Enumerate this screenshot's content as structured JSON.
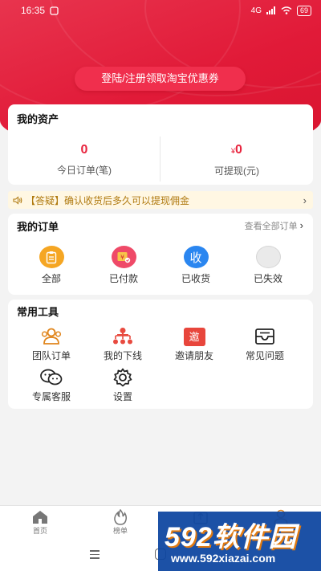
{
  "status_bar": {
    "time": "16:35",
    "network": "4G",
    "battery": "69"
  },
  "header": {
    "coupon_button": "登陆/注册领取淘宝优惠券"
  },
  "assets": {
    "title": "我的资产",
    "today_orders_value": "0",
    "today_orders_label": "今日订单(笔)",
    "withdrawable_currency": "¥",
    "withdrawable_value": "0",
    "withdrawable_label": "可提现(元)"
  },
  "notice": {
    "icon": "speaker-icon",
    "text": "【答疑】确认收货后多久可以提现佣金",
    "chevron": "›"
  },
  "orders": {
    "title": "我的订单",
    "see_all": "查看全部订单",
    "see_all_chevron": "›",
    "items": [
      {
        "label": "全部",
        "icon": "clipboard-icon",
        "color": "#f5a623"
      },
      {
        "label": "已付款",
        "icon": "paid-icon",
        "color": "#ef4a68"
      },
      {
        "label": "已收货",
        "icon": "received-icon",
        "glyph": "收",
        "color": "#2a86f0"
      },
      {
        "label": "已失效",
        "icon": "invalid-icon",
        "color": "#e6e6e6"
      }
    ]
  },
  "tools": {
    "title": "常用工具",
    "items": [
      {
        "label": "团队订单",
        "icon": "team-icon"
      },
      {
        "label": "我的下线",
        "icon": "hierarchy-icon"
      },
      {
        "label": "邀请朋友",
        "icon": "invite-icon",
        "glyph": "邀"
      },
      {
        "label": "常见问题",
        "icon": "inbox-icon"
      },
      {
        "label": "专属客服",
        "icon": "chat-icon"
      },
      {
        "label": "设置",
        "icon": "gear-icon"
      }
    ]
  },
  "tabbar": {
    "tabs": [
      {
        "label": "首页",
        "icon": "home-icon"
      },
      {
        "label": "榜单",
        "icon": "flame-icon"
      },
      {
        "label": "",
        "icon": "share-icon"
      },
      {
        "label": "",
        "icon": "user-icon"
      }
    ]
  },
  "watermark": {
    "brand": "592软件园",
    "url": "www.592xiazai.com"
  },
  "colors": {
    "brand_red": "#e11a38",
    "button_red": "#f02f4d",
    "accent_red": "#e8233d",
    "notice_bg": "#fff7e3",
    "notice_text": "#b07a10"
  }
}
